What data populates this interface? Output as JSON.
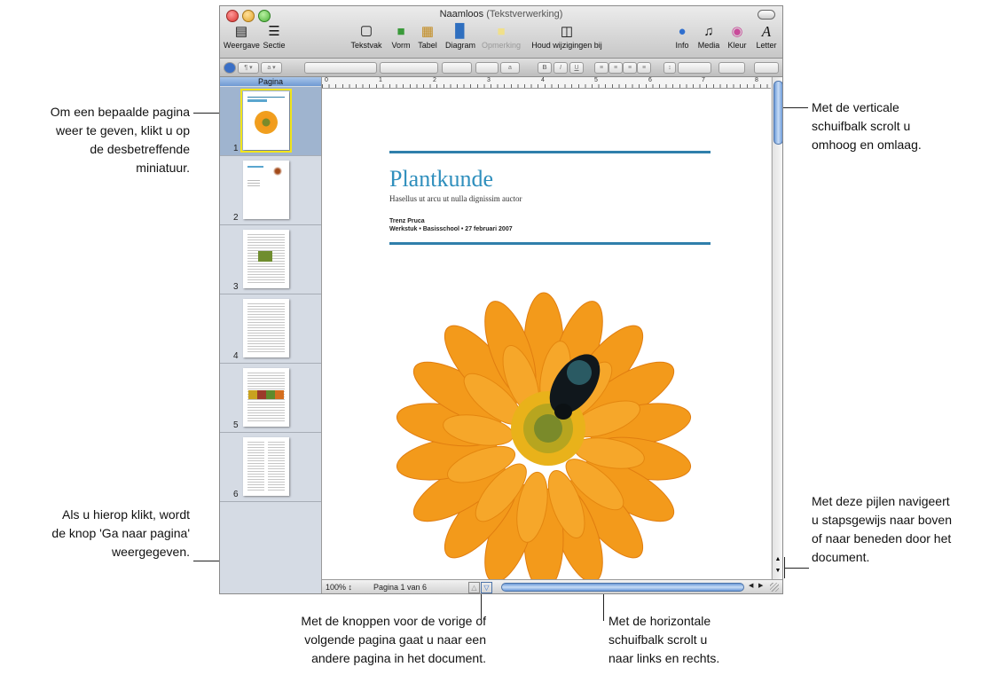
{
  "window": {
    "title": "Naamloos",
    "subtitle": "(Tekstverwerking)"
  },
  "toolbar": {
    "weergave": "Weergave",
    "sectie": "Sectie",
    "tekstvak": "Tekstvak",
    "vorm": "Vorm",
    "tabel": "Tabel",
    "diagram": "Diagram",
    "opmerking": "Opmerking",
    "houd": "Houd wijzigingen bij",
    "info": "Info",
    "media": "Media",
    "kleur": "Kleur",
    "letter": "Letter"
  },
  "format_bar": {
    "style_a": "a",
    "b": "B",
    "i": "I",
    "u": "U",
    "size_a": "a"
  },
  "sidebar": {
    "header": "Pagina",
    "pages": [
      "1",
      "2",
      "3",
      "4",
      "5",
      "6"
    ]
  },
  "ruler": [
    "0",
    "1",
    "2",
    "3",
    "4",
    "5",
    "6",
    "7",
    "8"
  ],
  "document": {
    "title": "Plantkunde",
    "subtitle": "Hasellus ut arcu ut nulla dignissim auctor",
    "author": "Trenz Pruca",
    "meta": "Werkstuk • Basisschool • 27 februari 2007"
  },
  "status": {
    "zoom": "100%",
    "page_indicator": "Pagina 1 van 6"
  },
  "callouts": {
    "thumbnail": [
      "Om een bepaalde pagina",
      "weer te geven, klikt u op",
      "de desbetreffende",
      "miniatuur."
    ],
    "vertical": [
      "Met de verticale",
      "schuifbalk scrolt u",
      "omhoog en omlaag."
    ],
    "goto": [
      "Als u hierop klikt, wordt",
      "de knop 'Ga naar pagina'",
      "weergegeven."
    ],
    "arrows": [
      "Met deze pijlen navigeert",
      "u stapsgewijs naar boven",
      "of naar beneden door het",
      "document."
    ],
    "prevnext": [
      "Met de knoppen voor de vorige of",
      "volgende pagina gaat u naar een",
      "andere pagina in het document."
    ],
    "horizontal": [
      "Met de horizontale",
      "schuifbalk scrolt u",
      "naar links en rechts."
    ]
  },
  "colors": {
    "title_blue": "#2f8fbd",
    "selection_yellow": "#f2e51b",
    "scroll_blue": "#6c9ad8"
  }
}
